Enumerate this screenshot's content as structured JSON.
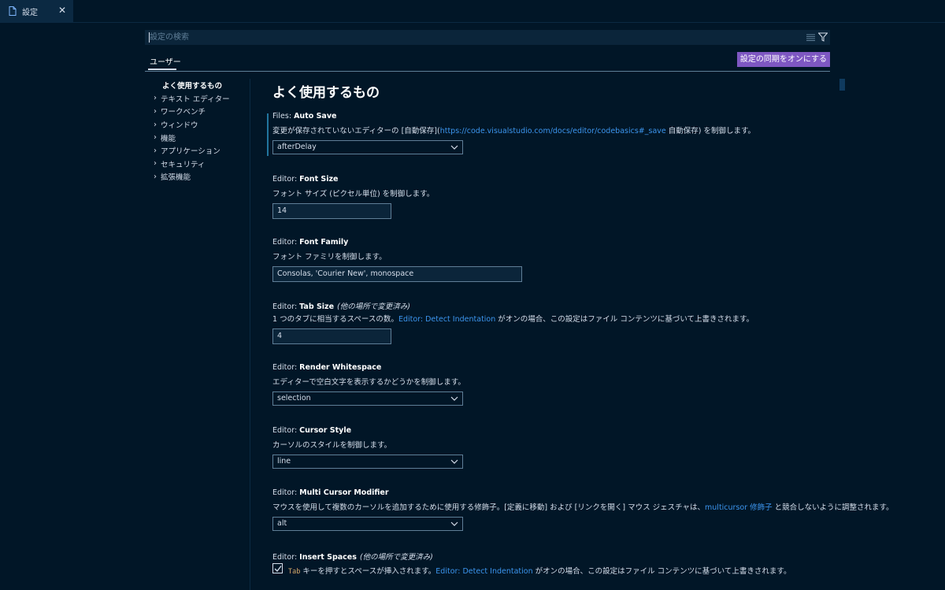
{
  "tab": {
    "title": "設定",
    "close": "✕"
  },
  "search": {
    "placeholder": "設定の検索"
  },
  "scope": {
    "user_tab": "ユーザー",
    "sync_button": "設定の同期をオンにする"
  },
  "toc": {
    "active": "よく使用するもの",
    "items": [
      "テキスト エディター",
      "ワークベンチ",
      "ウィンドウ",
      "機能",
      "アプリケーション",
      "セキュリティ",
      "拡張機能"
    ]
  },
  "section_title": "よく使用するもの",
  "settings": {
    "auto_save": {
      "category": "Files: ",
      "name": "Auto Save",
      "desc_before": "変更が保存されていないエディターの [自動保存](",
      "desc_link": "https://code.visualstudio.com/docs/editor/codebasics#_save",
      "desc_after": " 自動保存) を制御します。",
      "value": "afterDelay"
    },
    "font_size": {
      "category": "Editor: ",
      "name": "Font Size",
      "desc": "フォント サイズ (ピクセル単位) を制御します。",
      "value": "14"
    },
    "font_family": {
      "category": "Editor: ",
      "name": "Font Family",
      "desc": "フォント ファミリを制御します。",
      "value": "Consolas, 'Courier New', monospace"
    },
    "tab_size": {
      "category": "Editor: ",
      "name": "Tab Size",
      "modified": "(他の場所で変更済み)",
      "desc_before": "1 つのタブに相当するスペースの数。",
      "desc_link": "Editor: Detect Indentation",
      "desc_after": " がオンの場合、この設定はファイル コンテンツに基づいて上書きされます。",
      "value": "4"
    },
    "render_whitespace": {
      "category": "Editor: ",
      "name": "Render Whitespace",
      "desc": "エディターで空白文字を表示するかどうかを制御します。",
      "value": "selection"
    },
    "cursor_style": {
      "category": "Editor: ",
      "name": "Cursor Style",
      "desc": "カーソルのスタイルを制御します。",
      "value": "line"
    },
    "multi_cursor": {
      "category": "Editor: ",
      "name": "Multi Cursor Modifier",
      "desc_before": "マウスを使用して複数のカーソルを追加するために使用する修飾子。[定義に移動] および [リンクを開く] マウス ジェスチャは、",
      "desc_link": "multicursor 修飾子",
      "desc_after": " と競合しないように調整されます。",
      "value": "alt"
    },
    "insert_spaces": {
      "category": "Editor: ",
      "name": "Insert Spaces",
      "modified": "(他の場所で変更済み)",
      "desc_code": "Tab",
      "desc_before": " キーを押すとスペースが挿入されます。",
      "desc_link": "Editor: Detect Indentation",
      "desc_after": " がオンの場合、この設定はファイル コンテンツに基づいて上書きされます。",
      "checked": true
    }
  },
  "colors": {
    "background": "#011627",
    "accent": "#7e57c2",
    "link": "#3c95ee"
  }
}
